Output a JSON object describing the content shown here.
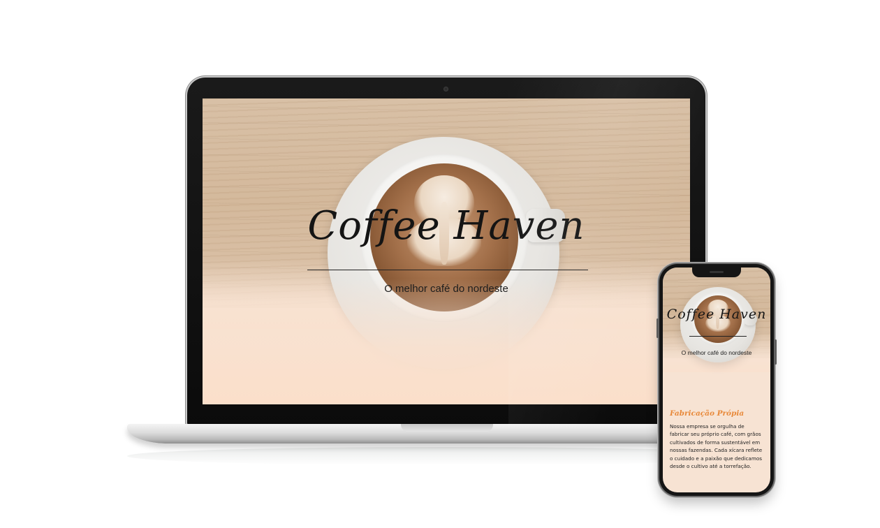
{
  "site": {
    "brand": "Coffee Haven",
    "tagline": "O melhor café do nordeste"
  },
  "section": {
    "title": "Fabricação Própia",
    "body": "Nossa empresa se orgulha de fabricar seu próprio café, com grãos cultivados de forma sustentável em nossas fazendas. Cada xícara reflete o cuidado e a paixão que dedicamos desde o cultivo até a torrefação."
  },
  "colors": {
    "accent": "#e8893a",
    "background_peach": "#f7e3d3",
    "text_dark": "#141414"
  }
}
